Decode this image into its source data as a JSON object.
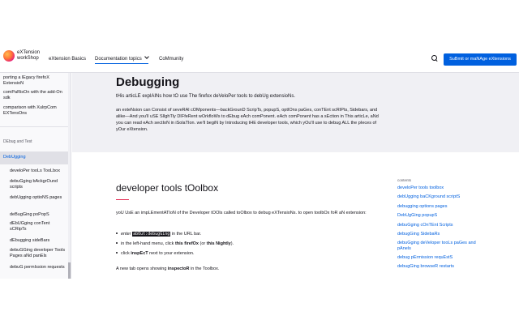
{
  "header": {
    "logo_line1": "eXTension",
    "logo_line2": "workShop",
    "nav": {
      "basics": "eXtension Basics",
      "topics": "Documentation topics",
      "community": "CoMmunity"
    },
    "cta": "SuBmit or maNAge eXtensions"
  },
  "sidebar": {
    "items_top": [
      "porting a lEgacy firefoX ExtensioN",
      "comPaRisOn with the add-On sdk",
      "comparison with XulrpCom EXTensOns"
    ],
    "group_label": "DEbug and Test",
    "active": "DebUgging",
    "sub_items": [
      "develoPer tooLs TooLbox",
      "debuGging bAckgrOund scripts",
      "debUgging optioNS pages",
      "deBugGing poPopS",
      "dEbUGging conTent sCRipTs",
      "dEbugging sideBars",
      "debuGGing developer Tools Pages aNd panEls",
      "debuG permIssion requests"
    ]
  },
  "hero": {
    "title": "Debugging",
    "subtitle": "tHis articLE explAINs how tO use The firefox deVeloPer tools to debUg extensioNs.",
    "body": "an exteNsion can Consist of seveRAl cOMponents—backGrounD ScripTs, popupS, optIOns paGes, conTEnt scRIPts, Sidebars, and alike—And you'll uSE SlIghTly DIFfeRent wOrkfloWs to dEbug eAch comPonent. eAch comPonent has a sEction in This articLe, aNd you can read eAch sectIoN in iSolaTIon. we'll begiN by Introducing tHE developer tools, which yOu'll use to debug ALL the pIeces of yOur eXtension."
  },
  "main": {
    "section_title": "developer tools tOolbox",
    "intro": "yoU UsE an impLEmentATIoN of the Developer tOOls called toOlbox to debug eXTensioNs. to open toolbOx foR aN extension:",
    "bullet1_pre": "enter ",
    "bullet1_code": "abOut:debugGing",
    "bullet1_post": " in the URL bar.",
    "bullet2_pre": "in the left-hand menu, click ",
    "bullet2_strong1": "this firefOx",
    "bullet2_mid": " (or ",
    "bullet2_strong2": "this Nightly",
    "bullet2_post": ").",
    "bullet3_pre": "click ",
    "bullet3_strong": "inspEcT",
    "bullet3_post": " next to your extension.",
    "footer_pre": "A new tab opens showing ",
    "footer_strong": "inspectoR",
    "footer_post": " in the Toolbox."
  },
  "toc": {
    "heading": "contents",
    "items": [
      "develoPer tools toolbox",
      "debUgging baCKground scriptS",
      "debugging options pages",
      "DebUgGing popupS",
      "debuGging cOnTEnt Scripts",
      "debugGing SidebaRs",
      "debuGging deVeloper tooLs paGes and pAnels",
      "debug pErmission requEstS",
      "debugGing browseR restarts"
    ]
  },
  "colors": {
    "accent": "#0060df",
    "hero_bg": "#f0f0f4",
    "heading_accent": "#e22850"
  }
}
